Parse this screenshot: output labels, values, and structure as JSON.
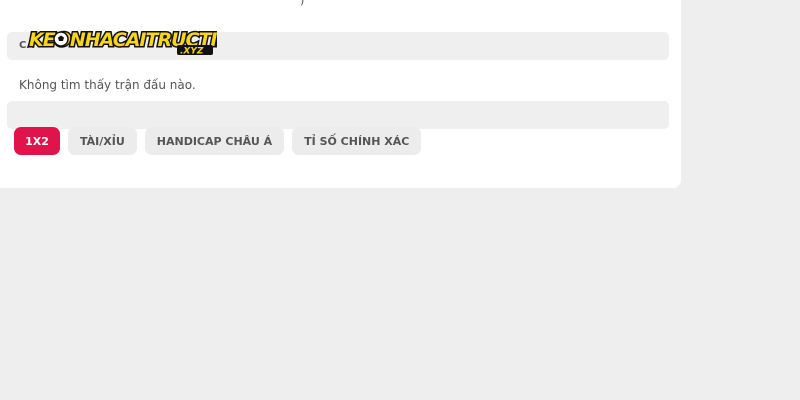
{
  "partial_top_text": ")",
  "odds_header_fragment": "CA",
  "empty_message": "Không tìm thấy trận đấu nào.",
  "logo": {
    "text": "KEONHACAITRUCTIEP",
    "suffix": ".XYZ"
  },
  "bet_tabs": [
    {
      "label": "1X2",
      "active": true
    },
    {
      "label": "TÀI/XỈU",
      "active": false
    },
    {
      "label": "HANDICAP CHÂU Á",
      "active": false
    },
    {
      "label": "TỈ SỐ CHÍNH XÁC",
      "active": false
    }
  ],
  "colors": {
    "accent": "#e0144a",
    "page_background": "#eeeeee",
    "card_background": "#ffffff",
    "bar_background": "#efefef"
  }
}
